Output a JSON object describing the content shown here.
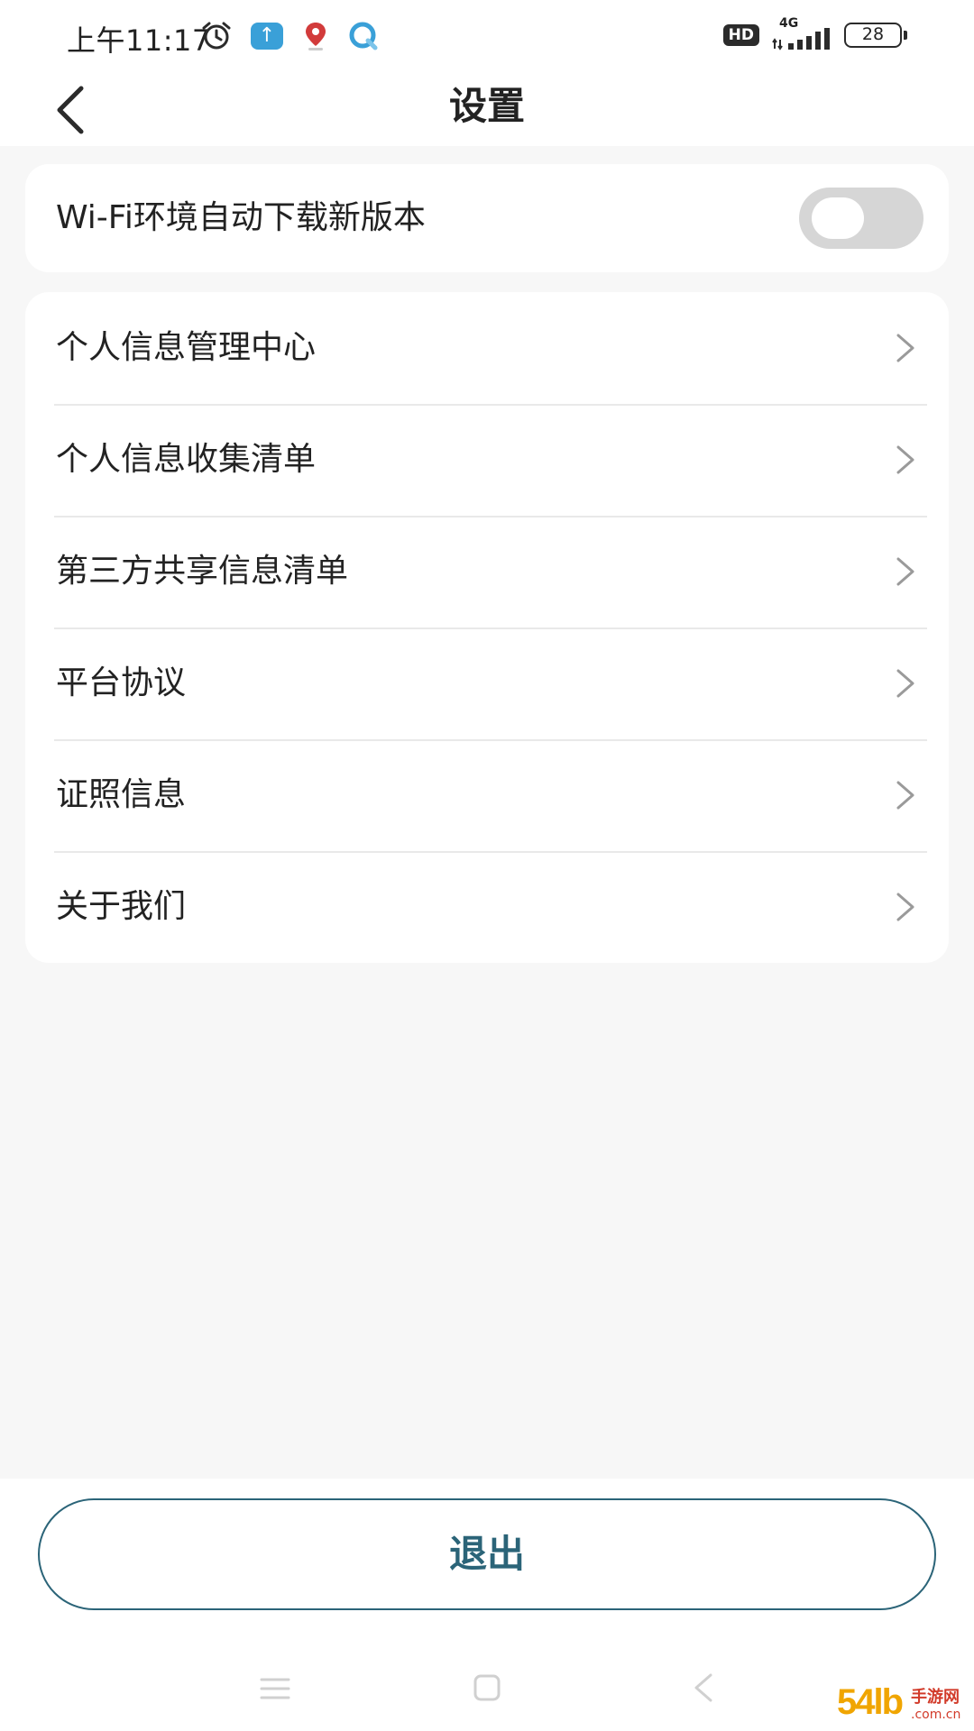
{
  "status_bar": {
    "time": "上午11:17",
    "hd": "HD",
    "network": "4G",
    "battery": "28"
  },
  "header": {
    "title": "设置"
  },
  "settings": {
    "wifi_auto_download": {
      "label": "Wi-Fi环境自动下载新版本",
      "enabled": false
    },
    "items": [
      {
        "label": "个人信息管理中心"
      },
      {
        "label": "个人信息收集清单"
      },
      {
        "label": "第三方共享信息清单"
      },
      {
        "label": "平台协议"
      },
      {
        "label": "证照信息"
      },
      {
        "label": "关于我们"
      }
    ]
  },
  "logout": {
    "label": "退出"
  },
  "watermark": {
    "number": "54lb",
    "name": "手游网",
    "domain": ".com.cn"
  },
  "colors": {
    "accent": "#2b6478",
    "toggle_off": "#d6d6d6",
    "background": "#f7f7f7"
  }
}
